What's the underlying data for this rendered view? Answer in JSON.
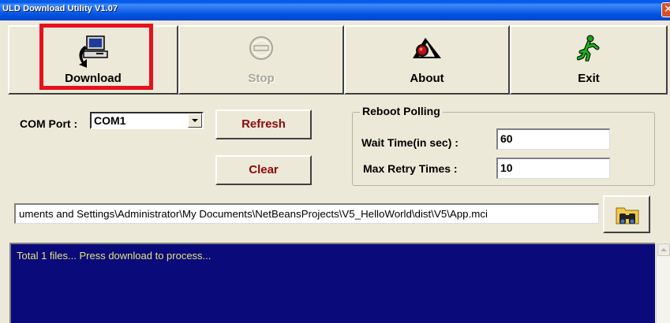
{
  "window": {
    "title": "ULD Download Utility  V1.07",
    "close_glyph": "✕"
  },
  "toolbar": {
    "download": {
      "label": "Download",
      "icon": "download-computer-icon"
    },
    "stop": {
      "label": "Stop",
      "icon": "stop-icon",
      "disabled": true
    },
    "about": {
      "label": "About",
      "icon": "about-logo-icon"
    },
    "exit": {
      "label": "Exit",
      "icon": "running-man-icon"
    }
  },
  "com": {
    "label": "COM Port :",
    "value": "COM1"
  },
  "buttons": {
    "refresh": "Refresh",
    "clear": "Clear"
  },
  "reboot": {
    "title": "Reboot Polling",
    "wait_label": "Wait Time(in sec) :",
    "wait_value": "60",
    "retry_label": "Max Retry Times :",
    "retry_value": "10"
  },
  "path": {
    "value": "uments and Settings\\Administrator\\My Documents\\NetBeansProjects\\V5_HelloWorld\\dist\\V5\\App.mci"
  },
  "browse": {
    "icon": "binoculars-folder-icon"
  },
  "log": {
    "text": "Total 1 files... Press download to process..."
  },
  "colors": {
    "highlight": "#E8101C",
    "log_bg": "#0A0A7A",
    "log_text": "#E6E27B",
    "button_text": "#8B0A0A"
  }
}
